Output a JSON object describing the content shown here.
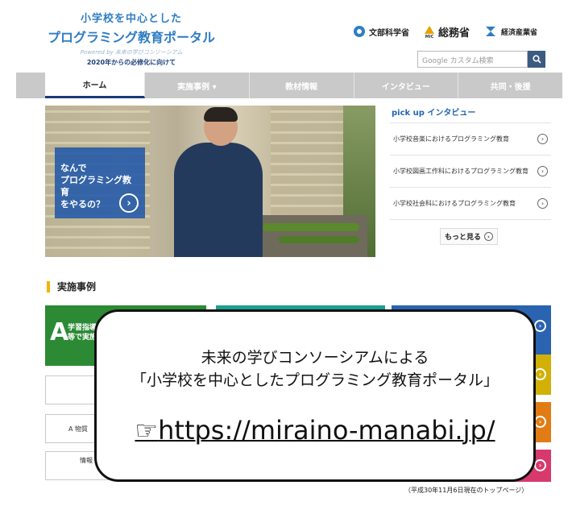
{
  "header": {
    "logo_line1": "小学校を中心とした",
    "logo_line2": "プログラミング教育ポータル",
    "logo_line3": "Powered by 未来の学びコンソーシアム",
    "logo_line4": "2020年からの必修化に向けて",
    "ministries": [
      {
        "label": "文部科学省",
        "icon": "mext-emblem-icon"
      },
      {
        "label": "総務省",
        "sublabel": "MIC",
        "icon": "mic-emblem-icon"
      },
      {
        "label": "経済産業省",
        "icon": "meti-emblem-icon"
      }
    ],
    "search": {
      "placeholder": "Google カスタム検索",
      "button_icon": "search-icon"
    }
  },
  "nav": {
    "items": [
      {
        "label": "ホーム",
        "active": true
      },
      {
        "label": "実施事例 ▾"
      },
      {
        "label": "教材情報"
      },
      {
        "label": "インタビュー"
      },
      {
        "label": "共同・後援"
      }
    ]
  },
  "hero": {
    "text": "なんで\nプログラミング教育\nをやるの？",
    "arrow_icon": "chevron-right-circle-icon"
  },
  "pickup": {
    "title": "pick up インタビュー",
    "items": [
      {
        "label": "小学校音楽におけるプログラミング教育"
      },
      {
        "label": "小学校図画工作科におけるプログラミング教育"
      },
      {
        "label": "小学校社会科におけるプログラミング教育"
      }
    ],
    "more_label": "もっと見る"
  },
  "section": {
    "title": "実施事例",
    "cards": {
      "a_letter": "A",
      "a_text": "学習指導\n等で実施"
    },
    "white_boxes": [
      {
        "label": ""
      },
      {
        "label": "A  物質"
      },
      {
        "label": "情報"
      }
    ]
  },
  "callout": {
    "line1": "未来の学びコンソーシアムによる",
    "line2": "「小学校を中心としたプログラミング教育ポータル」",
    "pointer": "☞",
    "url": "https://miraino-manabi.jp/"
  },
  "footnote": "（平成30年11月6日現在のトップページ）",
  "colors": {
    "brand_blue": "#2f7dc3",
    "nav_gray": "#c9c9c9",
    "green": "#2b8a33",
    "teal": "#1aa08e",
    "blue": "#2a63b0",
    "yellow": "#d1b108",
    "orange": "#e17c14",
    "pink": "#d8396d",
    "section_accent": "#f2b300"
  }
}
